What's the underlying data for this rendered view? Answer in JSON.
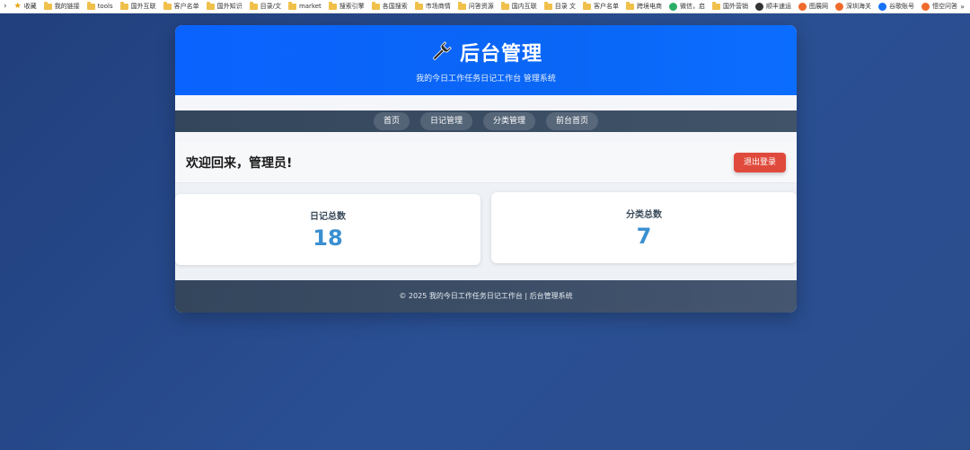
{
  "bookmarks": {
    "items": [
      {
        "label": "收藏",
        "icon": "star-icon"
      },
      {
        "label": "我的链接",
        "icon": "folder-icon"
      },
      {
        "label": "tools",
        "icon": "folder-icon"
      },
      {
        "label": "国外互联",
        "icon": "folder-icon"
      },
      {
        "label": "客户名单",
        "icon": "folder-icon"
      },
      {
        "label": "国外知识",
        "icon": "folder-icon"
      },
      {
        "label": "目录/文",
        "icon": "folder-icon"
      },
      {
        "label": "market",
        "icon": "folder-icon"
      },
      {
        "label": "搜索引擎",
        "icon": "folder-icon"
      },
      {
        "label": "各国搜索",
        "icon": "folder-icon"
      },
      {
        "label": "市场商情",
        "icon": "folder-icon"
      },
      {
        "label": "问答资源",
        "icon": "folder-icon"
      },
      {
        "label": "国内互联",
        "icon": "folder-icon"
      },
      {
        "label": "目录 文",
        "icon": "folder-icon"
      },
      {
        "label": "客户名单",
        "icon": "folder-icon"
      },
      {
        "label": "跨境电商",
        "icon": "folder-icon"
      },
      {
        "label": "微信，启",
        "icon": "wechat-icon"
      },
      {
        "label": "国外营销",
        "icon": "folder-icon"
      },
      {
        "label": "顺丰速运",
        "icon": "sf-icon"
      },
      {
        "label": "图展网",
        "icon": "site-icon"
      },
      {
        "label": "深圳海关",
        "icon": "site-icon"
      },
      {
        "label": "谷歌账号",
        "icon": "zhihu-icon"
      },
      {
        "label": "悟空问答",
        "icon": "site-icon"
      }
    ],
    "more": "»"
  },
  "header": {
    "icon": "wrench-icon",
    "title": "后台管理",
    "subtitle": "我的今日工作任务日记工作台 管理系统"
  },
  "nav": {
    "items": [
      "首页",
      "日记管理",
      "分类管理",
      "前台首页"
    ]
  },
  "welcome": {
    "text": "欢迎回来，管理员!",
    "logout_label": "退出登录"
  },
  "stats": [
    {
      "label": "日记总数",
      "value": "18"
    },
    {
      "label": "分类总数",
      "value": "7"
    }
  ],
  "footer": {
    "text": "© 2025 我的今日工作任务日记工作台 | 后台管理系统"
  },
  "colors": {
    "header_blue": "#0b63ff",
    "nav_dark": "#34465c",
    "logout_red": "#e04a3c",
    "stat_blue": "#3a8fd0",
    "background": "#2a4f93"
  }
}
